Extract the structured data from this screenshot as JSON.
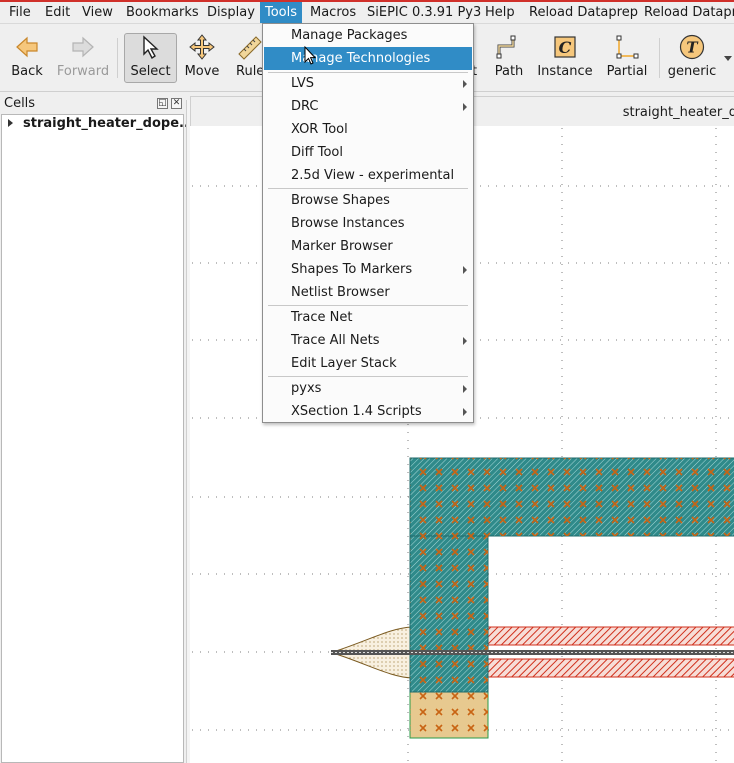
{
  "menubar": {
    "items": [
      "File",
      "Edit",
      "View",
      "Bookmarks",
      "Display",
      "Tools",
      "Macros",
      "SiEPIC 0.3.91 Py3",
      "Help",
      "Reload Dataprep",
      "Reload Dataprep"
    ]
  },
  "toolbar": {
    "back": "Back",
    "forward": "Forward",
    "select": "Select",
    "move": "Move",
    "ruler": "Ruler",
    "text_partial": "t",
    "path": "Path",
    "instance": "Instance",
    "partial": "Partial",
    "generic": "generic"
  },
  "cells_panel": {
    "title": "Cells",
    "tree": [
      {
        "label": "straight_heater_dope..."
      }
    ]
  },
  "view": {
    "tab_title": "straight_heater_d"
  },
  "tools_menu": {
    "items": [
      {
        "label": "Manage Packages",
        "submenu": false,
        "highlighted": false
      },
      {
        "label": "Manage Technologies",
        "submenu": false,
        "highlighted": true
      },
      {
        "label": "LVS",
        "submenu": true,
        "highlighted": false
      },
      {
        "label": "DRC",
        "submenu": true,
        "highlighted": false
      },
      {
        "label": "XOR Tool",
        "submenu": false,
        "highlighted": false
      },
      {
        "label": "Diff Tool",
        "submenu": false,
        "highlighted": false
      },
      {
        "label": "2.5d View - experimental",
        "submenu": false,
        "highlighted": false
      },
      {
        "label": "Browse Shapes",
        "submenu": false,
        "highlighted": false
      },
      {
        "label": "Browse Instances",
        "submenu": false,
        "highlighted": false
      },
      {
        "label": "Marker Browser",
        "submenu": false,
        "highlighted": false
      },
      {
        "label": "Shapes To Markers",
        "submenu": true,
        "highlighted": false
      },
      {
        "label": "Netlist Browser",
        "submenu": false,
        "highlighted": false
      },
      {
        "label": "Trace Net",
        "submenu": false,
        "highlighted": false
      },
      {
        "label": "Trace All Nets",
        "submenu": true,
        "highlighted": false
      },
      {
        "label": "Edit Layer Stack",
        "submenu": false,
        "highlighted": false
      },
      {
        "label": "pyxs",
        "submenu": true,
        "highlighted": false
      },
      {
        "label": "XSection 1.4 Scripts",
        "submenu": true,
        "highlighted": false
      }
    ]
  },
  "colors": {
    "accent": "#308cc6",
    "metal_fill": "#2f8a8a",
    "via_mark": "#c86414",
    "heater_red": "#d0301c",
    "taper_fill": "#e7c98f"
  }
}
